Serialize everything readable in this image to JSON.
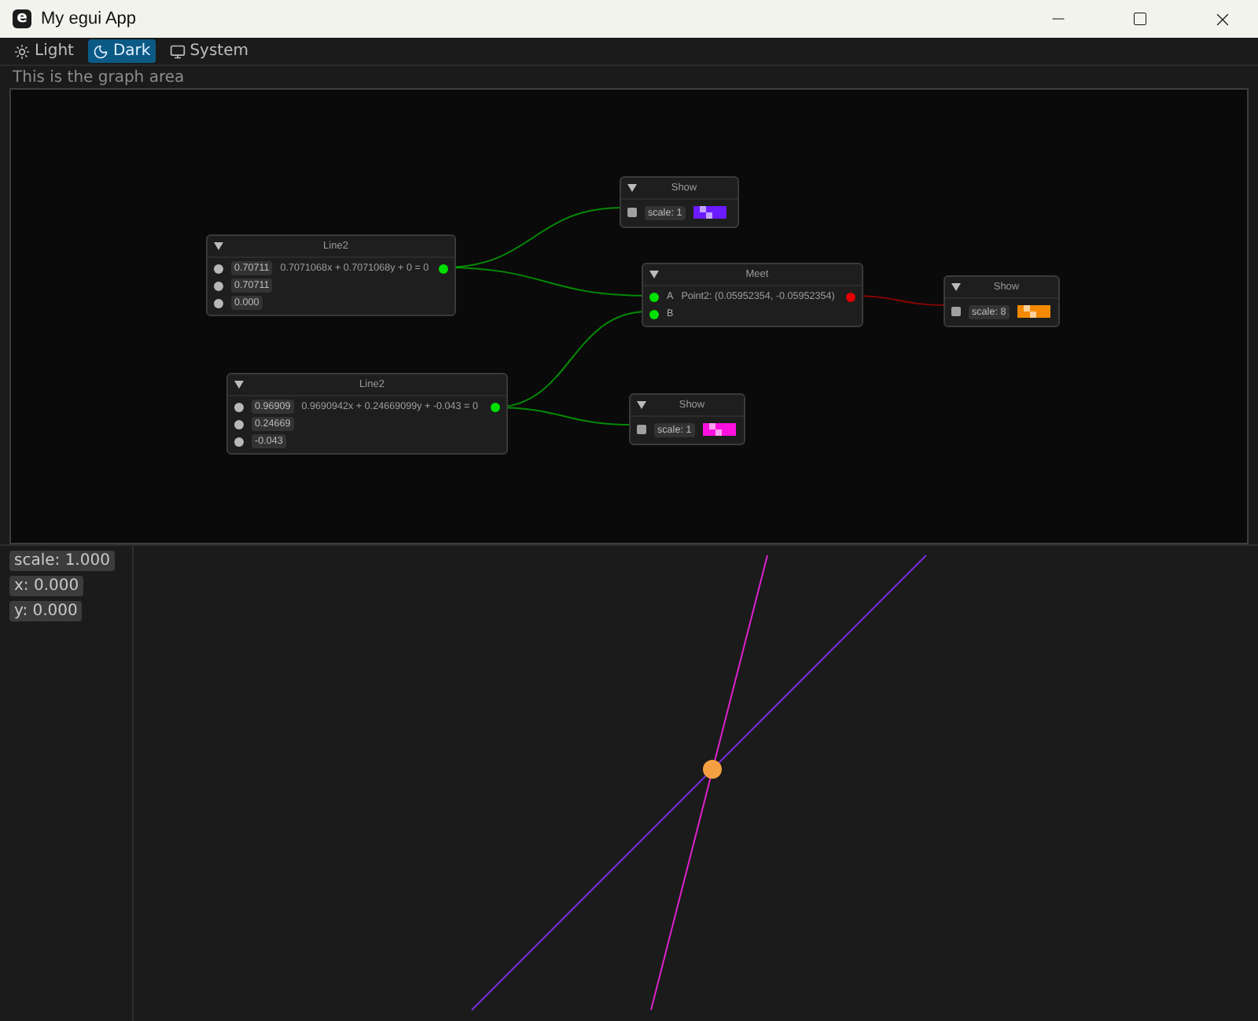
{
  "window": {
    "title": "My egui App",
    "icon_letter": "e"
  },
  "themes": [
    {
      "label": "Light",
      "kind": "sun",
      "selected": false
    },
    {
      "label": "Dark",
      "kind": "moon",
      "selected": true
    },
    {
      "label": "System",
      "kind": "monitor",
      "selected": false
    }
  ],
  "graph_label": "This is the graph area",
  "nodes": [
    {
      "kind": "line",
      "title": "Line2",
      "inputs": [
        "0.70711",
        "0.70711",
        "0.000"
      ],
      "output": {
        "text": "0.7071068x + 0.7071068y + 0 = 0",
        "color": "#00e000"
      }
    },
    {
      "kind": "show",
      "title": "Show",
      "scale": "scale: 1",
      "color": "#6a1bff"
    },
    {
      "kind": "meet",
      "title": "Meet",
      "inputs": [
        "A",
        "B"
      ],
      "output": {
        "text": "Point2: (0.05952354, -0.05952354)",
        "color": "#e00000"
      }
    },
    {
      "kind": "show",
      "title": "Show",
      "scale": "scale: 8",
      "color": "#f58a00"
    },
    {
      "kind": "line",
      "title": "Line2",
      "inputs": [
        "0.96909",
        "0.24669",
        "-0.043"
      ],
      "output": {
        "text": "0.9690942x + 0.24669099y + -0.043 = 0",
        "color": "#00e000"
      }
    },
    {
      "kind": "show",
      "title": "Show",
      "scale": "scale: 1",
      "color": "#ff10e0"
    }
  ],
  "readouts": [
    "scale: 1.000",
    "x: 0.000",
    "y: 0.000"
  ]
}
